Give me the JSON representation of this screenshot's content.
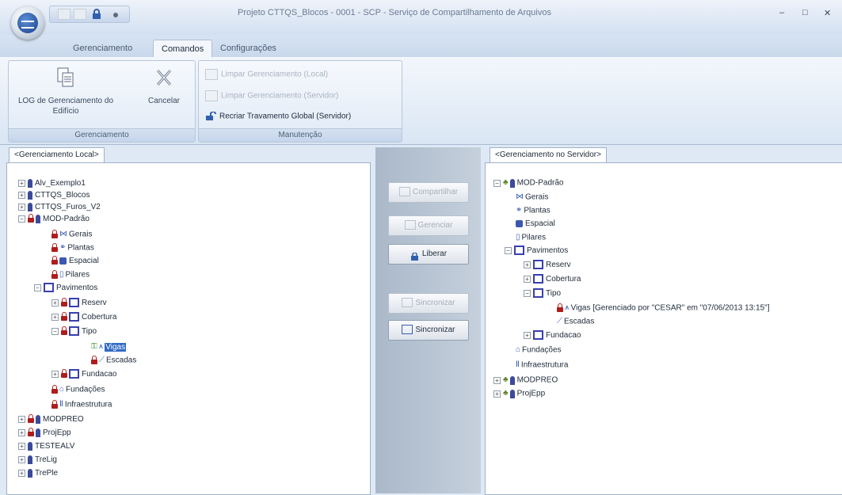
{
  "window": {
    "title": "Projeto CTTQS_Blocos - 0001 - SCP - Serviço de Compartilhamento de Arquivos",
    "minimize": "–",
    "maximize": "□",
    "close": "✕"
  },
  "ribbon": {
    "tabs": [
      "Gerenciamento",
      "Comandos",
      "Configurações"
    ],
    "active_tab": "Comandos",
    "groups": {
      "gerenciamento": {
        "label": "Gerenciamento",
        "log_button": "LOG de Gerenciamento do Edifício",
        "cancel_button": "Cancelar"
      },
      "manutencao": {
        "label": "Manutenção",
        "limpar_local": "Limpar Gerenciamento (Local)",
        "limpar_servidor": "Limpar Gerenciamento (Servidor)",
        "recriar": "Recriar Travamento Global (Servidor)"
      }
    }
  },
  "left_panel": {
    "tab": "<Gerenciamento Local>",
    "items": [
      "Alv_Exemplo1",
      "CTTQS_Blocos",
      "CTTQS_Furos_V2",
      "MOD-Padrão",
      "Gerais",
      "Plantas",
      "Espacial",
      "Pilares",
      "Pavimentos",
      "Reserv",
      "Cobertura",
      "Tipo",
      "Vigas",
      "Escadas",
      "Fundacao",
      "Fundações",
      "Infraestrutura",
      "MODPREO",
      "ProjEpp",
      "TESTEALV",
      "TreLig",
      "TrePle"
    ]
  },
  "middle": {
    "compartilhar": "Compartilhar",
    "gerenciar": "Gerenciar",
    "liberar": "Liberar",
    "sincronizar_disabled": "Sincronizar",
    "sincronizar": "Sincronizar"
  },
  "right_panel": {
    "tab": "<Gerenciamento no Servidor>",
    "items": [
      "MOD-Padrão",
      "Gerais",
      "Plantas",
      "Espacial",
      "Pilares",
      "Pavimentos",
      "Reserv",
      "Cobertura",
      "Tipo",
      "Vigas [Gerenciado por \"CESAR\" em \"07/06/2013 13:15\"]",
      "Escadas",
      "Fundacao",
      "Fundações",
      "Infraestrutura",
      "MODPREO",
      "ProjEpp"
    ]
  },
  "colors": {
    "lock_red": "#b01c1c",
    "selection_blue": "#316ac5",
    "ribbon_bg": "#dae6f4"
  }
}
